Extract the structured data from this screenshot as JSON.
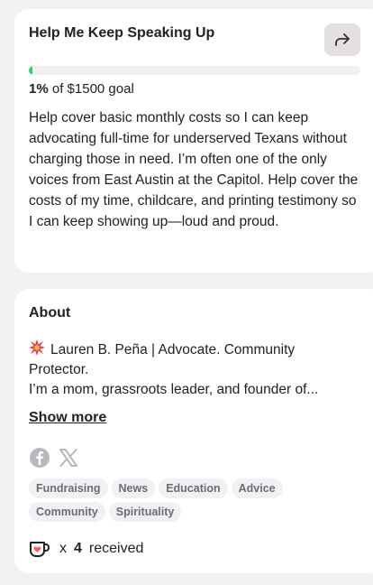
{
  "goal_card": {
    "title": "Help Me Keep Speaking Up",
    "progress_fraction": 0.01,
    "percent_label": "1%",
    "goal_suffix": "of $1500 goal",
    "description": "Help cover basic monthly costs so I can keep advocating full-time for underserved Texans without charging those in need. I’m often one of the only voices from East Austin at the Capitol. Help cover the costs of my time, childcare, and printing testimony so I can keep showing up—loud and proud."
  },
  "about_card": {
    "title": "About",
    "line1": "Lauren B. Peña | Advocate. Community Protector.",
    "line2": "I’m a mom, grassroots leader, and founder of...",
    "show_more": "Show more",
    "social_icons": [
      "facebook-icon",
      "x-icon"
    ],
    "tags": [
      "Fundraising",
      "News",
      "Education",
      "Advice",
      "Community",
      "Spirituality"
    ],
    "received_x": "x",
    "received_count": "4",
    "received_label": "received"
  },
  "colors": {
    "background": "#f1f0f3",
    "card": "#ffffff",
    "progress": "#2fd46e",
    "share_button": "#e4dfe2",
    "tag_bg": "#f1f0f3",
    "burst": "#e8344f",
    "kofi": "#ff5e5b"
  }
}
